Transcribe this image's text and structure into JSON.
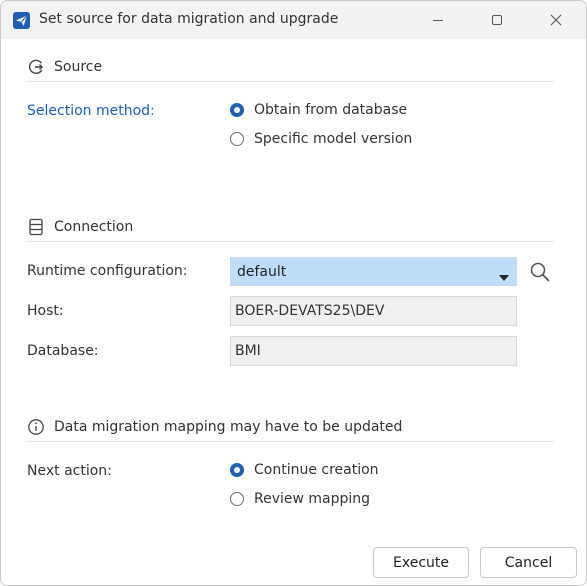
{
  "window": {
    "title": "Set source for data migration and upgrade",
    "app_icon": "send-arrow-icon"
  },
  "source": {
    "heading": "Source",
    "icon": "source-arrow-icon",
    "selection_label": "Selection method:",
    "options": [
      {
        "label": "Obtain from database",
        "checked": true
      },
      {
        "label": "Specific model version",
        "checked": false
      }
    ]
  },
  "connection": {
    "heading": "Connection",
    "icon": "database-icon",
    "runtime_label": "Runtime configuration:",
    "runtime_value": "default",
    "host_label": "Host:",
    "host_value": "BOER-DEVATS25\\DEV",
    "database_label": "Database:",
    "database_value": "BMI"
  },
  "notice": {
    "text": "Data migration mapping may have to be updated",
    "icon": "info-icon"
  },
  "next_action": {
    "label": "Next action:",
    "options": [
      {
        "label": "Continue creation",
        "checked": true
      },
      {
        "label": "Review mapping",
        "checked": false
      }
    ]
  },
  "buttons": {
    "execute": "Execute",
    "cancel": "Cancel"
  },
  "colors": {
    "accent": "#1e5fb3",
    "select_bg": "#bfdcf8"
  }
}
